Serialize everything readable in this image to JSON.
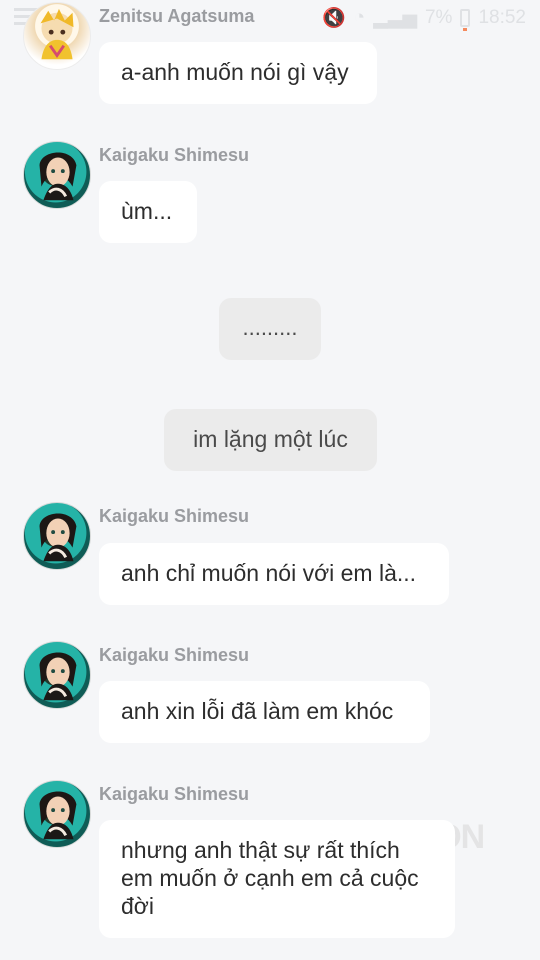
{
  "status": {
    "battery": "7%",
    "time": "18:52"
  },
  "messages": [
    {
      "sender": "Zenitsu Agatsuma",
      "text": "a-anh muốn nói gì vậy"
    },
    {
      "sender": "Kaigaku Shimesu",
      "text": "ùm..."
    },
    {
      "text": "........."
    },
    {
      "text": "im lặng một lúc"
    },
    {
      "sender": "Kaigaku Shimesu",
      "text": "anh chỉ muốn nói với em là..."
    },
    {
      "sender": "Kaigaku Shimesu",
      "text": "anh xin lỗi đã làm em khóc"
    },
    {
      "sender": "Kaigaku Shimesu",
      "text": "nhưng anh thật sự rất thích em muốn ở cạnh em cả cuộc đời"
    }
  ]
}
